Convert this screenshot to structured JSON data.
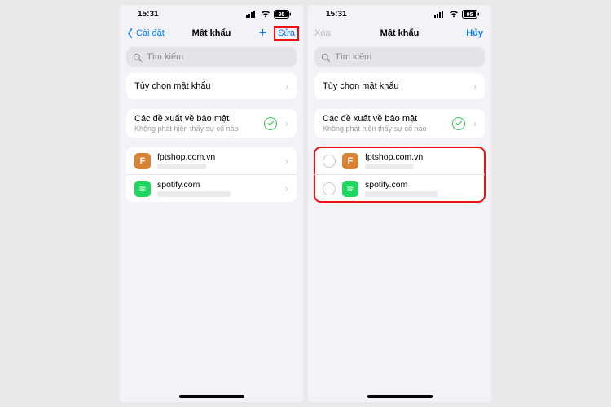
{
  "status": {
    "time": "15:31",
    "battery": "95"
  },
  "left": {
    "nav": {
      "back": "Cài đặt",
      "title": "Mật khẩu",
      "add": "+",
      "edit": "Sửa"
    },
    "search": {
      "placeholder": "Tìm kiếm"
    },
    "options_label": "Tùy chọn mật khẩu",
    "security": {
      "title": "Các đề xuất về bảo mật",
      "sub": "Không phát hiện thấy sự cố nào"
    },
    "accounts": [
      {
        "domain": "fptshop.com.vn",
        "icon_letter": "F",
        "icon_color": "orange"
      },
      {
        "domain": "spotify.com",
        "icon_letter": "",
        "icon_color": "green"
      }
    ]
  },
  "right": {
    "nav": {
      "delete": "Xóa",
      "title": "Mật khẩu",
      "cancel": "Hủy"
    },
    "search": {
      "placeholder": "Tìm kiếm"
    },
    "options_label": "Tùy chọn mật khẩu",
    "security": {
      "title": "Các đề xuất về bảo mật",
      "sub": "Không phát hiện thấy sự cố nào"
    },
    "accounts": [
      {
        "domain": "fptshop.com.vn",
        "icon_letter": "F",
        "icon_color": "orange"
      },
      {
        "domain": "spotify.com",
        "icon_letter": "",
        "icon_color": "green"
      }
    ]
  }
}
